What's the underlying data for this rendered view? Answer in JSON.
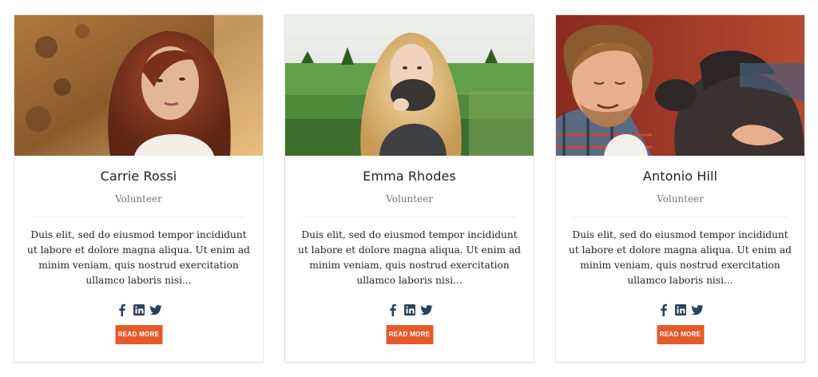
{
  "team": [
    {
      "name": "Carrie Rossi",
      "role": "Volunteer",
      "bio": "Duis elit, sed do eiusmod tempor incididunt ut labore et dolore magna aliqua. Ut enim ad minim veniam, quis nostrud exercitation ullamco laboris nisi...",
      "button_label": "READ MORE",
      "social_icons": [
        "facebook-icon",
        "linkedin-icon",
        "twitter-icon"
      ]
    },
    {
      "name": "Emma Rhodes",
      "role": "Volunteer",
      "bio": "Duis elit, sed do eiusmod tempor incididunt ut labore et dolore magna aliqua. Ut enim ad minim veniam, quis nostrud exercitation ullamco laboris nisi...",
      "button_label": "READ MORE",
      "social_icons": [
        "facebook-icon",
        "linkedin-icon",
        "twitter-icon"
      ]
    },
    {
      "name": "Antonio Hill",
      "role": "Volunteer",
      "bio": "Duis elit, sed do eiusmod tempor incididunt ut labore et dolore magna aliqua. Ut enim ad minim veniam, quis nostrud exercitation ullamco laboris nisi...",
      "button_label": "READ MORE",
      "social_icons": [
        "facebook-icon",
        "linkedin-icon",
        "twitter-icon"
      ]
    }
  ],
  "colors": {
    "button": "#e55a2b",
    "social_icon": "#2b4257",
    "name_text": "#222222",
    "role_text": "#777777"
  }
}
